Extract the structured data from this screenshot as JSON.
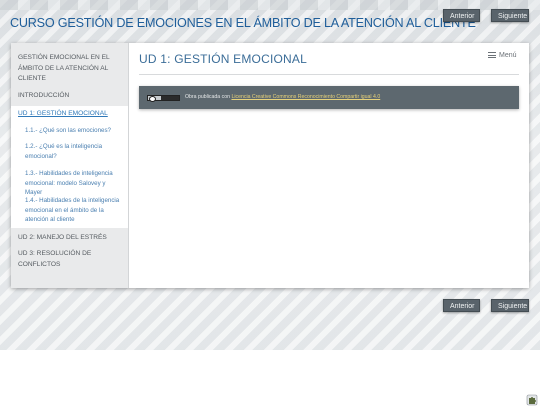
{
  "header": {
    "title": "CURSO GESTIÓN DE EMOCIONES EN EL ÁMBITO DE LA ATENCIÓN AL CLIENTE"
  },
  "nav": {
    "prev_label": "Anterior",
    "next_label": "Siguiente"
  },
  "sidebar": {
    "items": [
      {
        "label": "GESTIÓN EMOCIONAL EN EL ÁMBITO DE LA ATENCIÓN AL CLIENTE"
      },
      {
        "label": "INTRODUCCIÓN"
      },
      {
        "label": "UD 1: GESTIÓN EMOCIONAL"
      },
      {
        "label": "1.1.- ¿Qué son las emociones?"
      },
      {
        "label": "1.2.- ¿Qué es la inteligencia emocional?"
      },
      {
        "label": "1.3.- Habilidades de inteligencia emocional: modelo Salovey y Mayer"
      },
      {
        "label": "1.4.- Habilidades de la inteligencia emocional en el ámbito de la atención al cliente"
      },
      {
        "label": "UD 2: MANEJO DEL ESTRÉS"
      },
      {
        "label": "UD 3: RESOLUCIÓN DE CONFLICTOS"
      }
    ]
  },
  "content": {
    "title": "UD 1: GESTIÓN EMOCIONAL",
    "menu_label": "Menú",
    "license_prefix": "Obra publicada con",
    "license_link": "Licencia Creative Commons Reconocimiento Compartir igual 4.0"
  },
  "colors": {
    "title_blue": "#1f5e9a",
    "active_link": "#2f78b8",
    "license_bar": "#5d686f",
    "button": "#59636b"
  },
  "icons": [
    "menu-icon",
    "creative-commons-badge-icon",
    "puzzle-icon"
  ]
}
